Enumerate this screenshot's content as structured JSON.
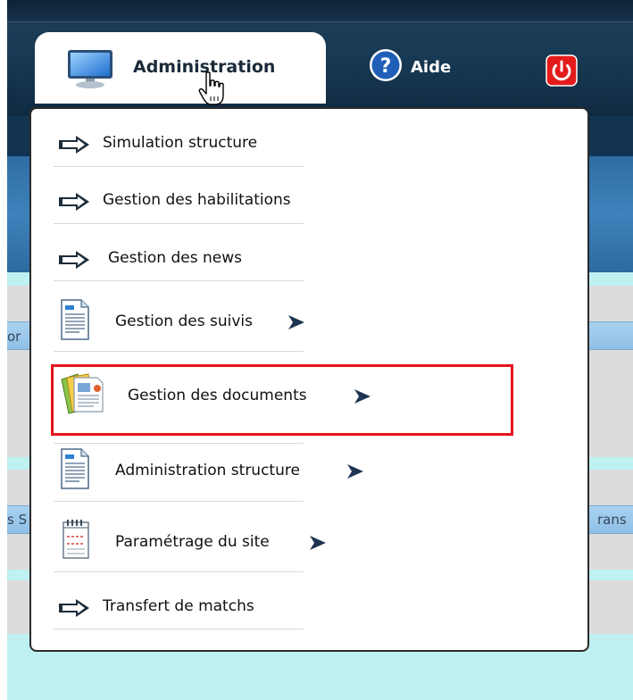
{
  "nav": {
    "administration_label": "Administration",
    "help_label": "Aide"
  },
  "menu": {
    "items": [
      {
        "label": "Simulation structure",
        "icon": "arrow-right-icon",
        "submenu": false
      },
      {
        "label": "Gestion des habilitations",
        "icon": "arrow-right-icon",
        "submenu": false
      },
      {
        "label": "Gestion des news",
        "icon": "arrow-right-icon",
        "submenu": false
      },
      {
        "label": "Gestion des suivis",
        "icon": "document-icon",
        "submenu": true
      },
      {
        "label": "Gestion des documents",
        "icon": "folder-documents-icon",
        "submenu": true
      },
      {
        "label": "Administration structure",
        "icon": "document-icon",
        "submenu": true
      },
      {
        "label": "Paramétrage du site",
        "icon": "notepad-icon",
        "submenu": true
      },
      {
        "label": "Transfert de matchs",
        "icon": "arrow-right-icon",
        "submenu": false
      }
    ],
    "highlighted_item": "Gestion des documents"
  },
  "background": {
    "edge_text_1": "or",
    "edge_text_2": "s S",
    "edge_text_3": "rans"
  },
  "colors": {
    "navbar": "#183a55",
    "highlight": "#e8141c",
    "power": "#e31b1b",
    "help": "#1f5fb8"
  }
}
